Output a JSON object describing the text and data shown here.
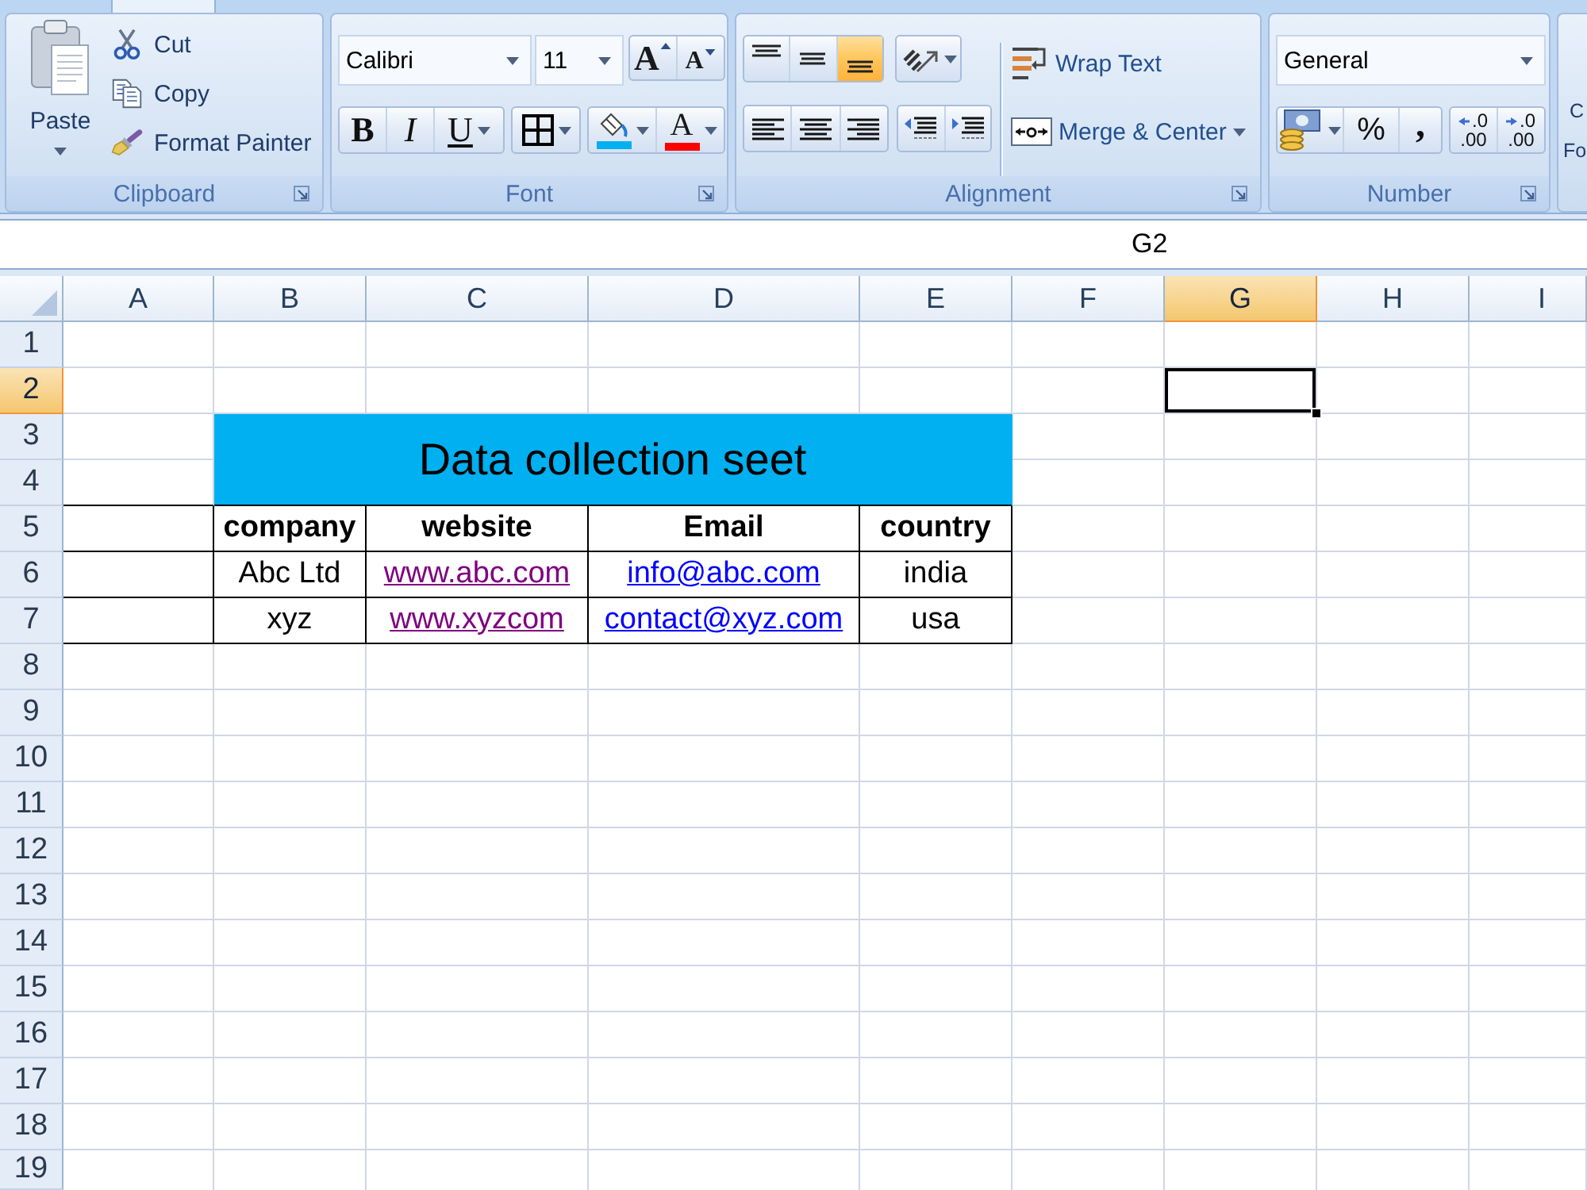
{
  "ribbon": {
    "clipboard": {
      "label": "Clipboard",
      "paste": "Paste",
      "actions": [
        {
          "kind": "cut",
          "label": "Cut"
        },
        {
          "kind": "copy",
          "label": "Copy"
        },
        {
          "kind": "format_painter",
          "label": "Format Painter"
        }
      ]
    },
    "font": {
      "label": "Font",
      "font_name": "Calibri",
      "font_size": "11",
      "size_buttons": [
        {
          "kind": "grow",
          "label": "A"
        },
        {
          "kind": "shrink",
          "label": "A"
        }
      ],
      "style_buttons": [
        {
          "kind": "bold",
          "label": "B"
        },
        {
          "kind": "italic",
          "label": "I"
        },
        {
          "kind": "underline",
          "label": "U"
        }
      ],
      "fill_color": {
        "color": "#00b0f0"
      },
      "font_color": {
        "label": "A",
        "color": "#ff0000"
      }
    },
    "alignment": {
      "label": "Alignment",
      "vertical": [
        {
          "kind": "top",
          "selected": false
        },
        {
          "kind": "middle",
          "selected": false
        },
        {
          "kind": "bottom",
          "selected": true
        }
      ],
      "wrap_text": "Wrap Text",
      "merge_center": "Merge & Center"
    },
    "number": {
      "label": "Number",
      "format": "General",
      "styles": [
        {
          "kind": "percent",
          "label": "%"
        },
        {
          "kind": "comma",
          "label": ","
        }
      ],
      "decimals": [
        {
          "kind": "increase",
          "lines": [
            ".0",
            ".00"
          ]
        },
        {
          "kind": "decrease",
          "lines": [
            ".0",
            ".00"
          ]
        }
      ]
    },
    "next_group": {
      "lines": [
        "C",
        "Fo"
      ]
    }
  },
  "name_box": "G2",
  "sheet": {
    "columns": [
      {
        "label": "A",
        "selected": false
      },
      {
        "label": "B",
        "selected": false
      },
      {
        "label": "C",
        "selected": false
      },
      {
        "label": "D",
        "selected": false
      },
      {
        "label": "E",
        "selected": false
      },
      {
        "label": "F",
        "selected": false
      },
      {
        "label": "G",
        "selected": true
      },
      {
        "label": "H",
        "selected": false
      },
      {
        "label": "I",
        "selected": false
      }
    ],
    "rows": [
      {
        "label": "1",
        "selected": false
      },
      {
        "label": "2",
        "selected": true
      },
      {
        "label": "3",
        "selected": false
      },
      {
        "label": "4",
        "selected": false
      },
      {
        "label": "5",
        "selected": false
      },
      {
        "label": "6",
        "selected": false
      },
      {
        "label": "7",
        "selected": false
      },
      {
        "label": "8",
        "selected": false
      },
      {
        "label": "9",
        "selected": false
      },
      {
        "label": "10",
        "selected": false
      },
      {
        "label": "11",
        "selected": false
      },
      {
        "label": "12",
        "selected": false
      },
      {
        "label": "13",
        "selected": false
      },
      {
        "label": "14",
        "selected": false
      },
      {
        "label": "15",
        "selected": false
      },
      {
        "label": "16",
        "selected": false
      },
      {
        "label": "17",
        "selected": false
      },
      {
        "label": "18",
        "selected": false
      },
      {
        "label": "19",
        "selected": false
      }
    ],
    "title": "Data collection seet",
    "table": {
      "columns": [
        "company",
        "website",
        "Email",
        "country"
      ],
      "rows": [
        [
          {
            "kind": "text",
            "text": "Abc Ltd"
          },
          {
            "kind": "visited_link",
            "text": "www.abc.com"
          },
          {
            "kind": "link",
            "text": "info@abc.com"
          },
          {
            "kind": "text",
            "text": "india"
          }
        ],
        [
          {
            "kind": "text",
            "text": "xyz"
          },
          {
            "kind": "visited_link",
            "text": "www.xyzcom"
          },
          {
            "kind": "link",
            "text": "contact@xyz.com"
          },
          {
            "kind": "text",
            "text": "usa"
          }
        ]
      ]
    }
  }
}
